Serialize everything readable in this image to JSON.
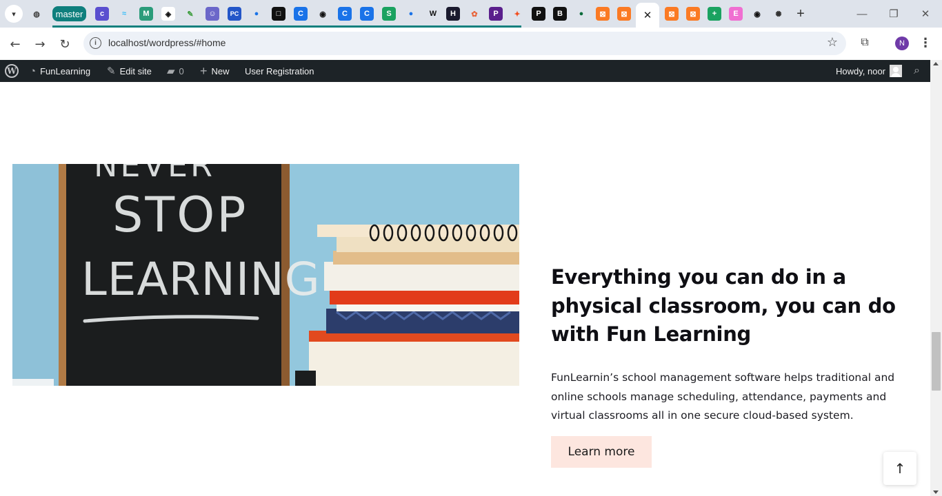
{
  "browser": {
    "tab_group_label": "master",
    "url": "localhost/wordpress/#home",
    "profile_initial": "N",
    "tab_icons": [
      {
        "name": "globe-icon",
        "glyph": "◍",
        "bg": "#ffffff00",
        "color": "#444"
      },
      {
        "name": "coolors-icon",
        "glyph": "c",
        "bg": "#5a4fcf",
        "color": "#fff"
      },
      {
        "name": "tailwind-icon",
        "glyph": "≈",
        "bg": "#ffffff00",
        "color": "#38bdf8"
      },
      {
        "name": "vue-docs-icon",
        "glyph": "M",
        "bg": "#2b9c7a",
        "color": "#fff"
      },
      {
        "name": "codepen-icon",
        "glyph": "◈",
        "bg": "#ffffff",
        "color": "#111"
      },
      {
        "name": "leaf-icon",
        "glyph": "✎",
        "bg": "#ffffff00",
        "color": "#3c9d3c"
      },
      {
        "name": "mascot-icon",
        "glyph": "☺",
        "bg": "#6b67c9",
        "color": "#fff"
      },
      {
        "name": "pc-icon",
        "glyph": "PC",
        "bg": "#2356c8",
        "color": "#fff"
      },
      {
        "name": "blue-dot-icon",
        "glyph": "●",
        "bg": "#ffffff00",
        "color": "#1a73e8"
      },
      {
        "name": "square-app-icon",
        "glyph": "□",
        "bg": "#111",
        "color": "#fff"
      },
      {
        "name": "blue-c-icon",
        "glyph": "C",
        "bg": "#1a73e8",
        "color": "#fff"
      },
      {
        "name": "github-icon",
        "glyph": "◉",
        "bg": "#ffffff00",
        "color": "#111"
      },
      {
        "name": "blue-c-icon-2",
        "glyph": "C",
        "bg": "#1a73e8",
        "color": "#fff"
      },
      {
        "name": "blue-c-icon-3",
        "glyph": "C",
        "bg": "#1a73e8",
        "color": "#fff"
      },
      {
        "name": "green-s-icon",
        "glyph": "S",
        "bg": "#1aa260",
        "color": "#fff"
      },
      {
        "name": "blue-dot-icon-2",
        "glyph": "●",
        "bg": "#ffffff00",
        "color": "#1a73e8"
      },
      {
        "name": "wikipedia-icon",
        "glyph": "W",
        "bg": "#ffffff00",
        "color": "#111"
      },
      {
        "name": "hackerrank-icon",
        "glyph": "H",
        "bg": "#1a1a2e",
        "color": "#fff"
      },
      {
        "name": "octopus-icon",
        "glyph": "✿",
        "bg": "#ffffff00",
        "color": "#e8643a"
      },
      {
        "name": "php-icon",
        "glyph": "P",
        "bg": "#5a1f8c",
        "color": "#fff"
      },
      {
        "name": "figma-icon",
        "glyph": "✦",
        "bg": "#ffffff00",
        "color": "#f24e1e"
      },
      {
        "name": "paypal-icon",
        "glyph": "P",
        "bg": "#111",
        "color": "#fff"
      },
      {
        "name": "bold-b-icon",
        "glyph": "B",
        "bg": "#111",
        "color": "#fff"
      },
      {
        "name": "bot-icon",
        "glyph": "●",
        "bg": "#ffffff00",
        "color": "#0a6b3a"
      },
      {
        "name": "xampp-icon",
        "glyph": "⊠",
        "bg": "#fb7a24",
        "color": "#fff"
      },
      {
        "name": "xampp-icon-2",
        "glyph": "⊠",
        "bg": "#fb7a24",
        "color": "#fff"
      },
      {
        "name": "xampp-icon-3",
        "glyph": "⊠",
        "bg": "#fb7a24",
        "color": "#fff"
      },
      {
        "name": "xampp-icon-4",
        "glyph": "⊠",
        "bg": "#fb7a24",
        "color": "#fff"
      },
      {
        "name": "sheets-icon",
        "glyph": "+",
        "bg": "#1aa260",
        "color": "#fff"
      },
      {
        "name": "elementor-icon",
        "glyph": "E",
        "bg": "#f06fd1",
        "color": "#fff"
      },
      {
        "name": "github-icon-2",
        "glyph": "◉",
        "bg": "#ffffff00",
        "color": "#111"
      },
      {
        "name": "openai-icon",
        "glyph": "✺",
        "bg": "#ffffff00",
        "color": "#333"
      }
    ]
  },
  "wp_admin_bar": {
    "site_name": "FunLearning",
    "edit_site": "Edit site",
    "comments_count": "0",
    "new_label": "New",
    "user_registration": "User Registration",
    "howdy": "Howdy, noor"
  },
  "hero": {
    "chalkboard_text": [
      "NEVER",
      "STOP",
      "LEARNING"
    ],
    "heading": "Everything you can do in a physical classroom, you can do with Fun Learning",
    "body": "FunLearnin’s school management software helps traditional and online schools manage scheduling, attendance, payments and virtual classrooms all in one secure cloud-based system.",
    "button_label": "Learn more"
  },
  "scroll_to_top_glyph": "↑",
  "colors": {
    "tab_group": "#0f7f7d",
    "wp_bar": "#1d2327",
    "button_bg": "#fde6df",
    "heading": "#0f0f14"
  }
}
